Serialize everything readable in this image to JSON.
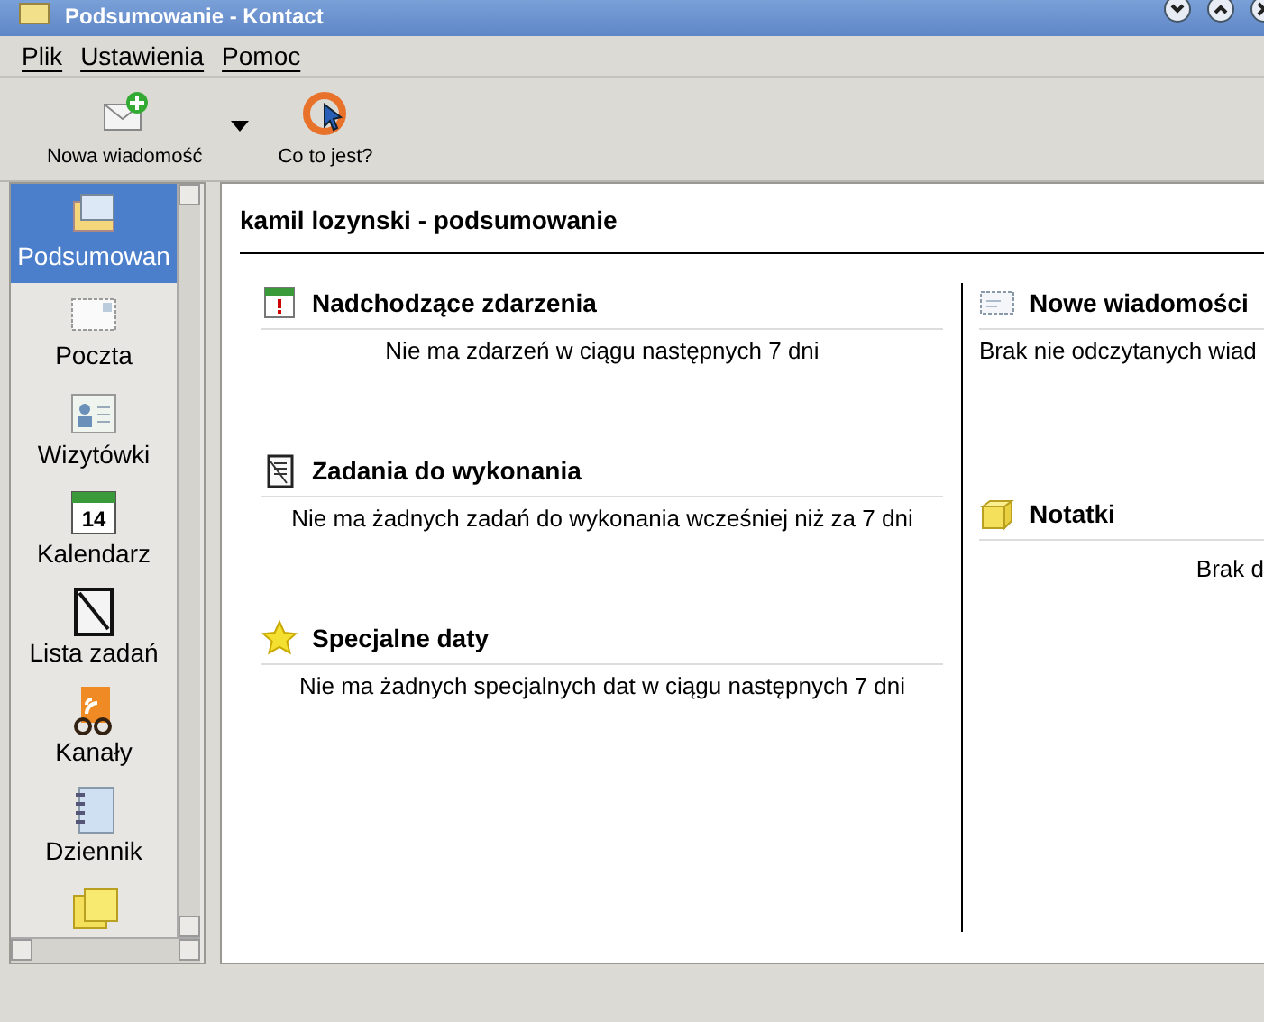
{
  "window": {
    "title": "Podsumowanie - Kontact"
  },
  "menu": [
    "Plik",
    "Ustawienia",
    "Pomoc"
  ],
  "toolbar": [
    {
      "label": "Nowa wiadomość",
      "dropdown": true
    },
    {
      "label": "Co to jest?",
      "dropdown": false
    }
  ],
  "sidebar": {
    "items": [
      {
        "label": "Podsumowan",
        "selected": true
      },
      {
        "label": "Poczta",
        "selected": false
      },
      {
        "label": "Wizytówki",
        "selected": false
      },
      {
        "label": "Kalendarz",
        "selected": false,
        "icon_text": "14"
      },
      {
        "label": "Lista zadań",
        "selected": false
      },
      {
        "label": "Kanały",
        "selected": false
      },
      {
        "label": "Dziennik",
        "selected": false
      },
      {
        "selected": false
      }
    ]
  },
  "summary": {
    "title": "kamil lozynski - podsumowanie",
    "columns": [
      [
        {
          "title": "Nadchodzące zdarzenia",
          "text": "Nie ma zdarzeń w ciągu następnych 7 dni"
        },
        {
          "title": "Zadania do wykonania",
          "text": "Nie ma żadnych zadań do wykonania wcześniej niż za 7 dni"
        },
        {
          "title": "Specjalne daty",
          "text": "Nie ma żadnych specjalnych dat w ciągu następnych 7 dni"
        }
      ],
      [
        {
          "title": "Nowe wiadomości",
          "text": "Brak nie odczytanych wiad"
        },
        {
          "title": "Notatki",
          "text": "Brak d"
        }
      ]
    ]
  }
}
